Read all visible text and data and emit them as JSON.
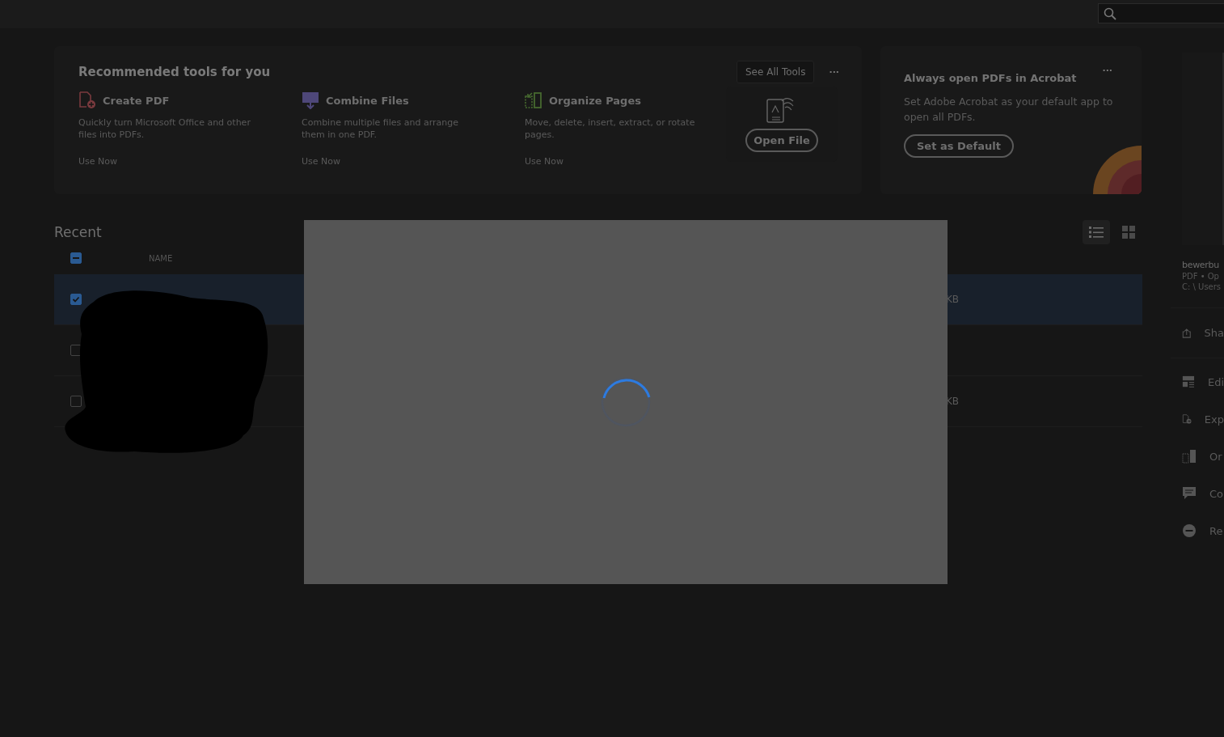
{
  "recommended": {
    "title": "Recommended tools for you",
    "see_all": "See All Tools",
    "more": "···",
    "tools": [
      {
        "kind": "create",
        "name": "Create PDF",
        "description": "Quickly turn Microsoft Office and other files into PDFs.",
        "action": "Use Now"
      },
      {
        "kind": "combine",
        "name": "Combine Files",
        "description": "Combine multiple files and arrange them in one PDF.",
        "action": "Use Now"
      },
      {
        "kind": "organize",
        "name": "Organize Pages",
        "description": "Move, delete, insert, extract, or rotate pages.",
        "action": "Use Now"
      }
    ],
    "open_file": "Open File"
  },
  "default_card": {
    "title": "Always open PDFs in Acrobat",
    "description": "Set Adobe Acrobat as your default app to open all PDFs.",
    "button": "Set as Default",
    "more": "···"
  },
  "recent": {
    "title": "Recent",
    "views": [
      {
        "kind": "list",
        "selected": true
      },
      {
        "kind": "grid",
        "selected": false
      }
    ],
    "header_partial": true,
    "columns": [
      "NAME"
    ],
    "rows": [
      {
        "selected": true,
        "checked": true,
        "size": "KB"
      },
      {
        "selected": false,
        "checked": false
      },
      {
        "selected": false,
        "checked": false,
        "size": "KB"
      }
    ]
  },
  "details": {
    "file_name": "bewerbu",
    "file_meta": "PDF  •  Op",
    "file_path": "C: \\ Users",
    "actions": [
      {
        "kind": "share",
        "label": "Sha"
      },
      {
        "kind": "edit",
        "label": "Edi"
      },
      {
        "kind": "export",
        "label": "Exp"
      },
      {
        "kind": "organize",
        "label": "Or"
      },
      {
        "kind": "comment",
        "label": "Co"
      },
      {
        "kind": "remove",
        "label": "Re"
      }
    ]
  },
  "modal": {
    "loading": true
  }
}
